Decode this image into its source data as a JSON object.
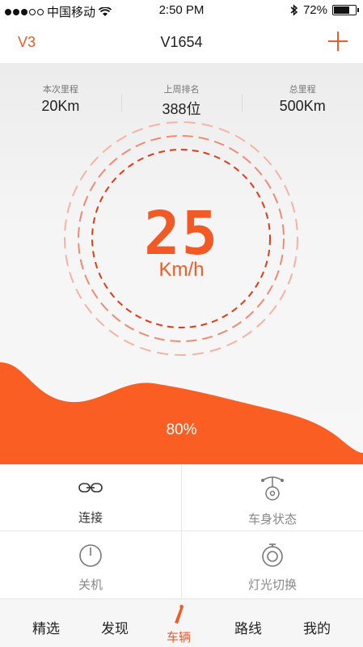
{
  "status_bar": {
    "carrier": "中国移动",
    "time": "2:50 PM",
    "battery": "72%",
    "battery_level": 0.72
  },
  "nav": {
    "left_label": "V3",
    "title": "V1654",
    "add_icon": "plus-icon"
  },
  "stats": [
    {
      "label": "本次里程",
      "value": "20Km"
    },
    {
      "label": "上周排名",
      "value": "388位"
    },
    {
      "label": "总里程",
      "value": "500Km"
    }
  ],
  "speed": {
    "value": "25",
    "unit": "Km/h"
  },
  "battery_level": {
    "text": "80%",
    "fraction": 0.8
  },
  "controls": [
    {
      "label": "连接",
      "icon": "link-icon"
    },
    {
      "label": "车身状态",
      "icon": "vehicle-status-icon"
    },
    {
      "label": "关机",
      "icon": "power-icon"
    },
    {
      "label": "灯光切换",
      "icon": "light-switch-icon"
    }
  ],
  "tabs": [
    {
      "label": "精选",
      "active": false
    },
    {
      "label": "发现",
      "active": false
    },
    {
      "label": "车辆",
      "active": true
    },
    {
      "label": "路线",
      "active": false
    },
    {
      "label": "我的",
      "active": false
    }
  ],
  "colors": {
    "accent": "#f15a24",
    "ring_dark": "#e23b1a",
    "ring_light": "#f4a08a"
  }
}
